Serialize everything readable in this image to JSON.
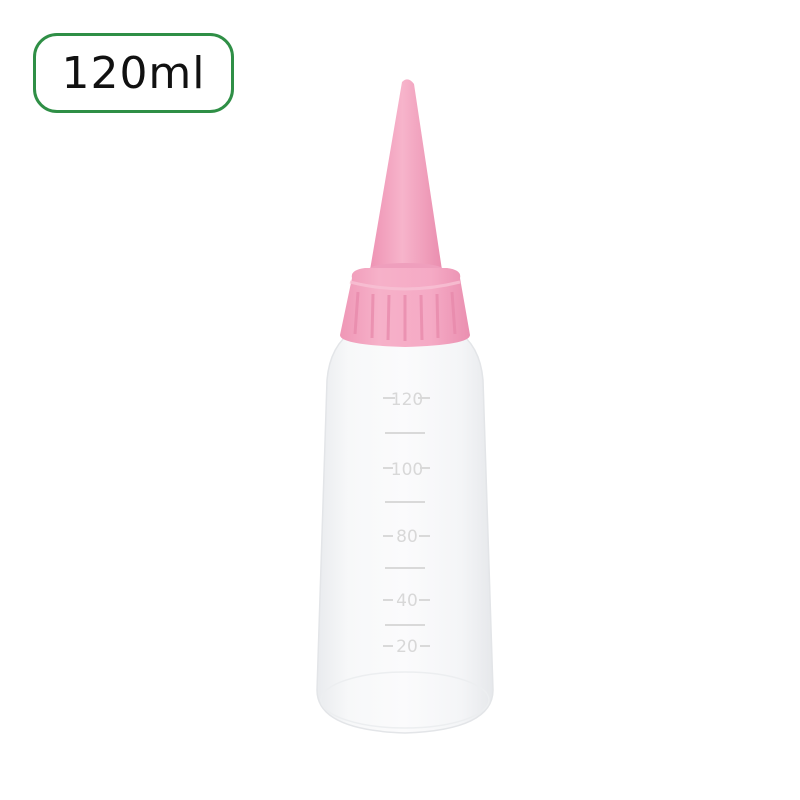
{
  "badge": {
    "text": "120ml"
  },
  "bottle": {
    "graduations": [
      "120",
      "100",
      "80",
      "40",
      "20"
    ],
    "cap_color": "#f4a7c3",
    "nozzle_color": "#f3a3c0",
    "body_color": "#f6f7f8",
    "badge_border_color": "#2f8f46"
  }
}
